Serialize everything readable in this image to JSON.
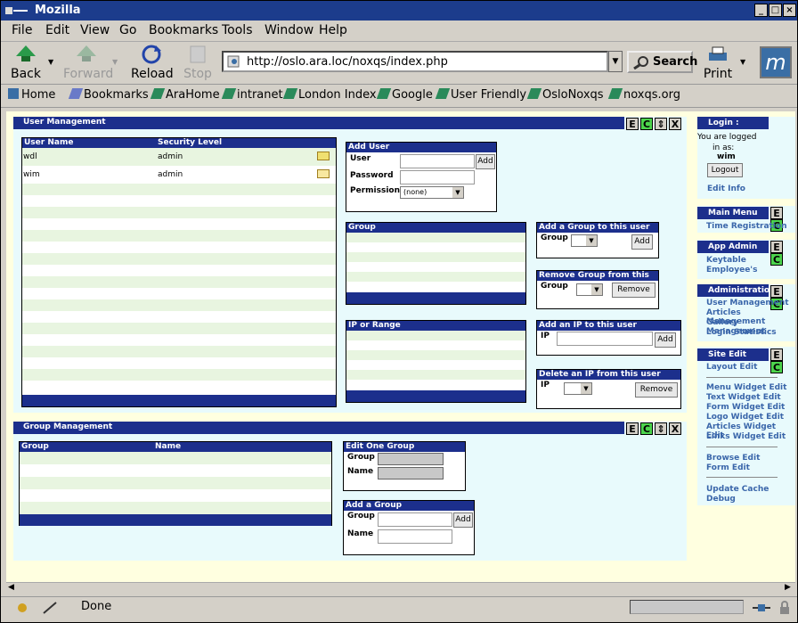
{
  "window": {
    "title": "Mozilla"
  },
  "menu": [
    "File",
    "Edit",
    "View",
    "Go",
    "Bookmarks",
    "Tools",
    "Window",
    "Help"
  ],
  "nav": {
    "back": "Back",
    "forward": "Forward",
    "reload": "Reload",
    "stop": "Stop",
    "url": "http://oslo.ara.loc/noxqs/index.php",
    "search": "Search",
    "print": "Print",
    "logo": "m"
  },
  "bookmarks": [
    "Home",
    "Bookmarks",
    "AraHome",
    "intranet",
    "London Index",
    "Google",
    "User Friendly",
    "OsloNoxqs",
    "noxqs.org"
  ],
  "user_mgmt": {
    "title": "User Management",
    "ctrl": [
      "E",
      "C",
      "⇕",
      "X"
    ],
    "cols": [
      "User Name",
      "Security Level"
    ],
    "users": [
      {
        "name": "wdl",
        "level": "admin"
      },
      {
        "name": "wim",
        "level": "admin"
      }
    ]
  },
  "add_user": {
    "title": "Add User",
    "user": "User",
    "password": "Password",
    "permission": "Permission",
    "perm_value": "(none)",
    "add": "Add"
  },
  "group_list": {
    "title": "Group"
  },
  "add_group_user": {
    "title": "Add a Group to this user",
    "group": "Group",
    "add": "Add"
  },
  "remove_group": {
    "title": "Remove Group from this user",
    "group": "Group",
    "remove": "Remove"
  },
  "ip_list": {
    "title": "IP or Range"
  },
  "add_ip": {
    "title": "Add an IP to this user",
    "ip": "IP",
    "add": "Add"
  },
  "delete_ip": {
    "title": "Delete an IP from this user",
    "ip": "IP",
    "remove": "Remove"
  },
  "group_mgmt": {
    "title": "Group Management",
    "ctrl": [
      "E",
      "C",
      "⇕",
      "X"
    ],
    "cols": [
      "Group",
      "Name"
    ]
  },
  "edit_group": {
    "title": "Edit One Group",
    "group": "Group",
    "name": "Name"
  },
  "add_group": {
    "title": "Add a Group",
    "group": "Group",
    "name": "Name",
    "add": "Add"
  },
  "sidebar": {
    "login": {
      "title": "Login :",
      "line1": "You are logged",
      "line2": "in as:",
      "user": "wim",
      "logout": "Logout",
      "edit": "Edit Info"
    },
    "main_menu": {
      "title": "Main Menu",
      "items": [
        "Time Registration"
      ]
    },
    "app_admin": {
      "title": "App Admin",
      "items": [
        "Keytable",
        "Employee's"
      ]
    },
    "administration": {
      "title": "Administration",
      "items": [
        "User Management",
        "Articles Management",
        "Gallery Management",
        "Login Statistics"
      ]
    },
    "site_edit": {
      "title": "Site Edit",
      "items": [
        "Layout Edit",
        "Menu Widget Edit",
        "Text Widget Edit",
        "Form Widget Edit",
        "Logo Widget Edit",
        "Articles Widget Edit",
        "Links Widget Edit",
        "Browse Edit",
        "Form Edit",
        "Update Cache",
        "Debug"
      ]
    }
  },
  "status": {
    "text": "Done"
  }
}
